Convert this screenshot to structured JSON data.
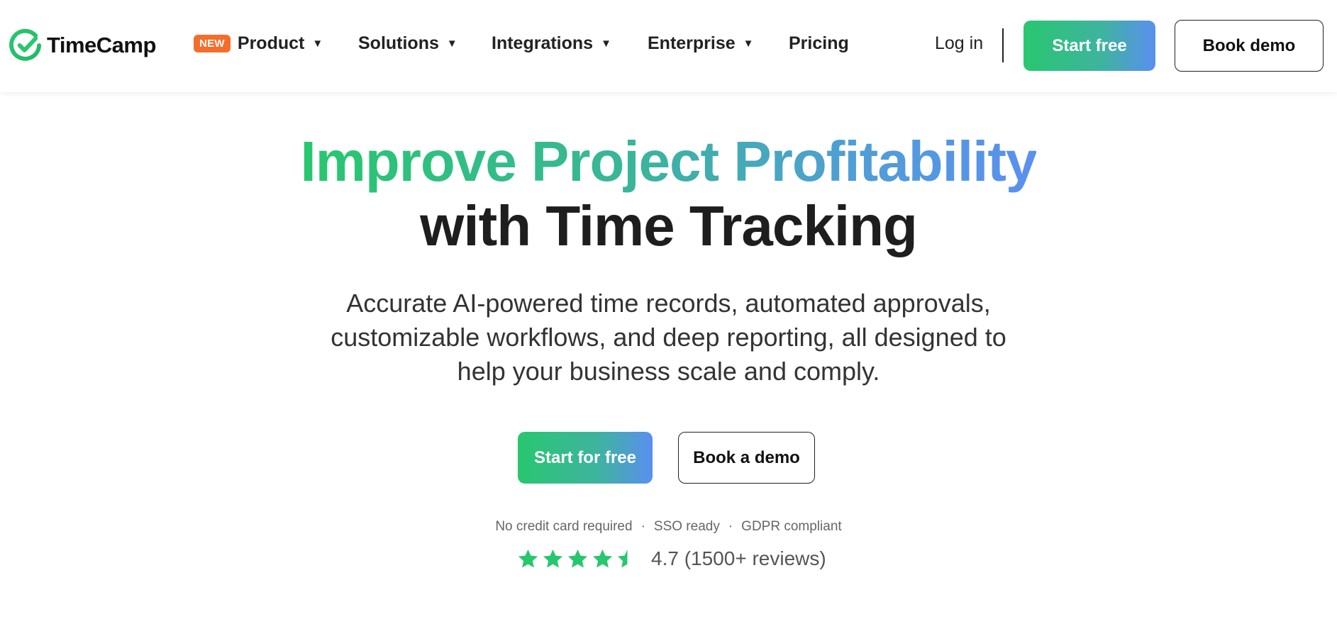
{
  "brand": {
    "name": "TimeCamp",
    "accent": "#28c76f",
    "accent_end": "#5b8ff0",
    "badge_color": "#f46d2b"
  },
  "nav": {
    "items": [
      {
        "label": "Product",
        "badge": "NEW",
        "has_caret": true
      },
      {
        "label": "Solutions",
        "has_caret": true
      },
      {
        "label": "Integrations",
        "has_caret": true
      },
      {
        "label": "Enterprise",
        "has_caret": true
      },
      {
        "label": "Pricing",
        "has_caret": false
      }
    ],
    "login_label": "Log in",
    "start_label": "Start free",
    "demo_label": "Book demo"
  },
  "hero": {
    "headline_gradient": "Improve Project Profitability",
    "headline_plain": "with Time Tracking",
    "subtitle_lines": [
      "Accurate AI-powered time records, automated approvals,",
      "customizable workflows, and deep reporting, all designed to",
      "help your business scale and comply."
    ],
    "cta_primary": "Start for free",
    "cta_secondary": "Book a demo",
    "assurances": [
      "No credit card required",
      "SSO ready",
      "GDPR compliant"
    ],
    "separator": "·",
    "rating": {
      "stars": 4.5,
      "text": "4.7 (1500+ reviews)",
      "star_color": "#28c76f"
    }
  }
}
